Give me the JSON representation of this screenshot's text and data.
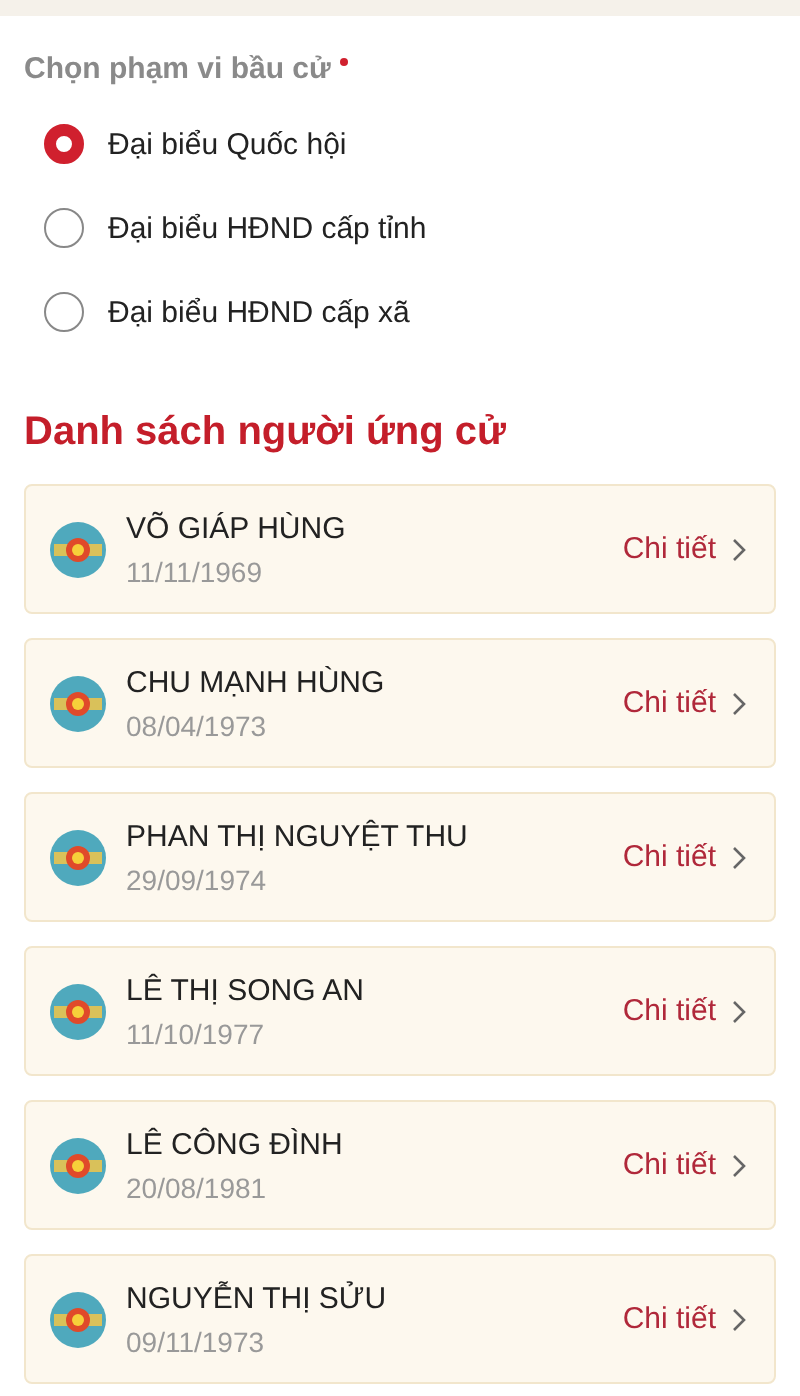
{
  "scope": {
    "label": "Chọn phạm vi bầu cử",
    "required": true,
    "options": [
      {
        "label": "Đại biểu Quốc hội",
        "selected": true
      },
      {
        "label": "Đại biểu HĐND cấp tỉnh",
        "selected": false
      },
      {
        "label": "Đại biểu HĐND cấp xã",
        "selected": false
      }
    ]
  },
  "candidates": {
    "title": "Danh sách người ứng cử",
    "items": [
      {
        "name": "VÕ GIÁP HÙNG",
        "birth_date": "11/11/1969",
        "action": "Chi tiết"
      },
      {
        "name": "CHU MẠNH HÙNG",
        "birth_date": "08/04/1973",
        "action": "Chi tiết"
      },
      {
        "name": "PHAN THỊ NGUYỆT THU",
        "birth_date": "29/09/1974",
        "action": "Chi tiết"
      },
      {
        "name": "LÊ THỊ SONG AN",
        "birth_date": "11/10/1977",
        "action": "Chi tiết"
      },
      {
        "name": "LÊ CÔNG ĐÌNH",
        "birth_date": "20/08/1981",
        "action": "Chi tiết"
      },
      {
        "name": "NGUYỄN THỊ SỬU",
        "birth_date": "09/11/1973",
        "action": "Chi tiết"
      }
    ]
  }
}
